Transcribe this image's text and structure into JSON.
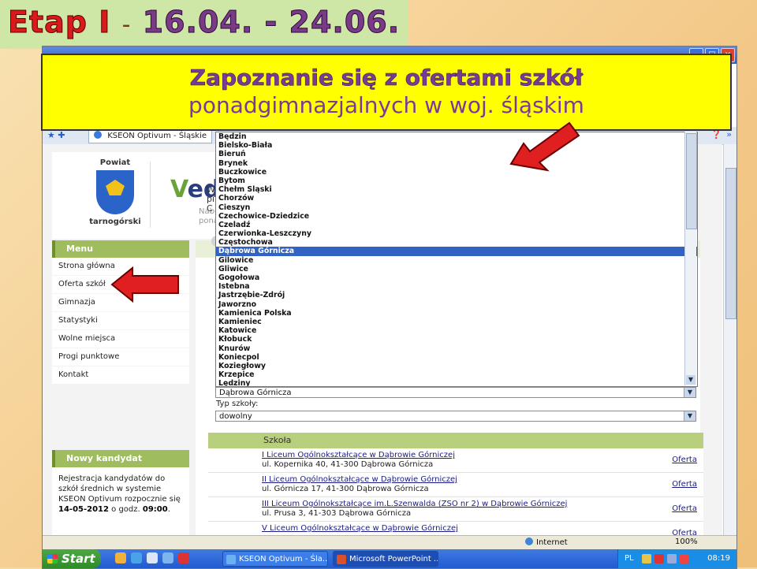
{
  "slide": {
    "title_etap": "Etap I",
    "title_dash": "-",
    "title_dates": "16.04. - 24.06.",
    "callout_line1": "Zapoznanie się z ofertami szkół",
    "callout_line2": "ponadgimnazjalnych w woj. śląskim"
  },
  "browser": {
    "tab_title": "KSEON Optivum - Śląskie",
    "status_zone": "Internet",
    "zoom": "100%"
  },
  "site": {
    "crest_top": "Powiat",
    "crest_bottom": "tarnogórski",
    "logo_text": "edu",
    "logo_sub_1": "Nabór S",
    "logo_sub_2": "ponadg",
    "menu_title": "Menu",
    "menu_items": [
      "Strona główna",
      "Oferta szkół",
      "Gimnazja",
      "Statystyki",
      "Wolne miejsca",
      "Progi punktowe",
      "Kontakt"
    ],
    "new_candidate_title": "Nowy kandydat",
    "new_candidate_text_1": "Rejestracja kandydatów do szkół średnich w systemie KSEON Optivum rozpocznie się ",
    "new_candidate_date": "14-05-2012",
    "new_candidate_text_2": " o godz. ",
    "new_candidate_time": "09:00",
    "new_candidate_end": "."
  },
  "partial_text": {
    "left_1": "W",
    "left_2": "pi",
    "left_3": "C",
    "right_1": "ej",
    "right_2": "ez",
    "right_3": "y"
  },
  "dropdown": {
    "options": [
      "Będzin",
      "Bielsko-Biała",
      "Bieruń",
      "Brynek",
      "Buczkowice",
      "Bytom",
      "Chełm Śląski",
      "Chorzów",
      "Cieszyn",
      "Czechowice-Dziedzice",
      "Czeladź",
      "Czerwionka-Leszczyny",
      "Częstochowa",
      "Dąbrowa Górnicza",
      "Gilowice",
      "Gliwice",
      "Gogołowa",
      "Istebna",
      "Jastrzębie-Zdrój",
      "Jaworzno",
      "Kamienica Polska",
      "Kamieniec",
      "Katowice",
      "Kłobuck",
      "Knurów",
      "Koniecpol",
      "Koziegłowy",
      "Krzepice",
      "Lędziny"
    ],
    "selected": "Dąbrowa Górnicza",
    "school_type_label": "Typ szkoły:",
    "school_type_value": "dowolny"
  },
  "table": {
    "header": "Szkoła",
    "rows": [
      {
        "name": "I Liceum Ogólnokształcące w Dąbrowie Górniczej",
        "address": "ul. Kopernika 40, 41-300 Dąbrowa Górnicza",
        "link": "Oferta"
      },
      {
        "name": "II Liceum Ogólnokształcące w Dąbrowie Górniczej",
        "address": "ul. Górnicza 17, 41-300 Dąbrowa Górnicza",
        "link": "Oferta"
      },
      {
        "name": "III Liceum Ogólnokształcące im.L.Szenwalda (ZSO nr 2) w Dąbrowie Górniczej",
        "address": "ul. Prusa 3, 41-303 Dąbrowa Górnicza",
        "link": "Oferta"
      },
      {
        "name": "V Liceum Ogólnokształcące w Dąbrowie Górniczej",
        "address": "",
        "link": "Oferta"
      }
    ]
  },
  "taskbar": {
    "start": "Start",
    "task1": "KSEON Optivum - Śla...",
    "task2": "Microsoft PowerPoint ...",
    "lang": "PL",
    "clock": "08:19"
  },
  "colors": {
    "callout_bg": "#ffff00",
    "title_red": "#d91a1a",
    "title_purple": "#7a3a96",
    "menu_green": "#9fbc5e",
    "selection_blue": "#3163c5",
    "arrow_red": "#e02020"
  }
}
